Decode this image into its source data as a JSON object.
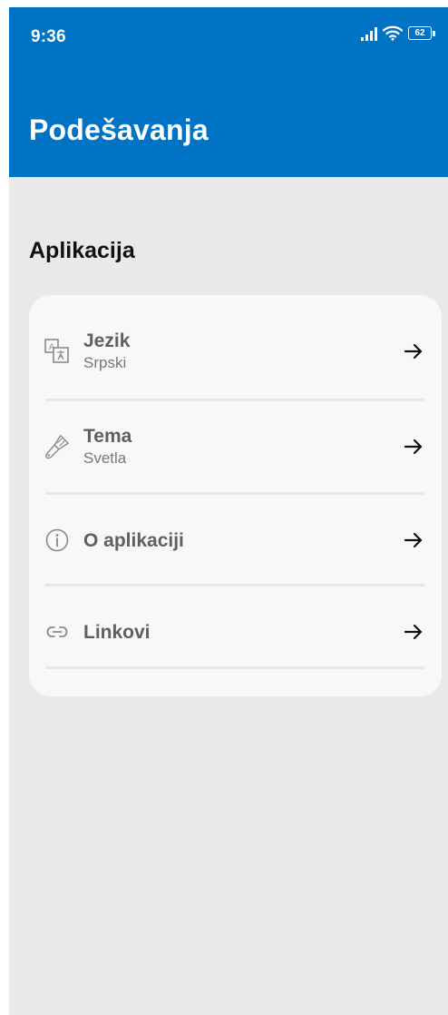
{
  "status_bar": {
    "time": "9:36",
    "battery": "62",
    "icons": [
      "signal-icon",
      "wifi-icon",
      "battery-icon"
    ]
  },
  "header": {
    "title": "Podešavanja",
    "background_color": "#0073c4"
  },
  "section": {
    "title": "Aplikacija"
  },
  "settings": {
    "items": [
      {
        "title": "Jezik",
        "subtitle": "Srpski",
        "icon": "translate-icon"
      },
      {
        "title": "Tema",
        "subtitle": "Svetla",
        "icon": "brush-icon"
      },
      {
        "title": "O aplikaciji",
        "icon": "info-icon"
      },
      {
        "title": "Linkovi",
        "icon": "link-icon"
      }
    ],
    "chevron_icon": "arrow-right-icon"
  }
}
